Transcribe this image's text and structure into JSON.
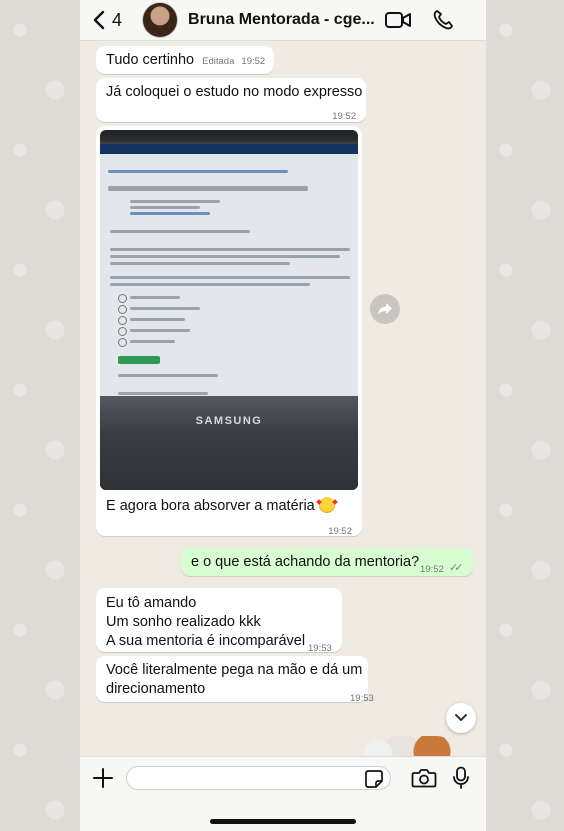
{
  "header": {
    "back_count": "4",
    "contact_name": "Bruna Mentorada - cge...",
    "icons": [
      "chevron-left-icon",
      "video-call-icon",
      "phone-call-icon"
    ]
  },
  "messages": [
    {
      "direction": "in",
      "text": "Tudo certinho",
      "edited_label": "Editada",
      "time": "19:52"
    },
    {
      "direction": "in",
      "text": "Já coloquei o estudo no modo expresso",
      "time": "19:52"
    },
    {
      "direction": "in",
      "type": "image",
      "image_text": "SAMSUNG",
      "caption": "E agora bora absorver a matéria",
      "caption_emoji": "smiling-face-with-hearts",
      "time": "19:52"
    },
    {
      "direction": "out",
      "text": "e o que está achando da mentoria?",
      "time": "19:52",
      "status": "read"
    },
    {
      "direction": "in",
      "lines": [
        "Eu tô amando",
        "Um sonho realizado kkk",
        "A sua mentoria é incomparável"
      ],
      "time": "19:53"
    },
    {
      "direction": "in",
      "lines": [
        "Você literalmente pega na mão e dá um",
        "direcionamento"
      ],
      "time": "19:53"
    }
  ],
  "composer": {
    "value": "",
    "icons": [
      "plus-icon",
      "sticker-icon",
      "camera-icon",
      "microphone-icon"
    ]
  },
  "colors": {
    "chat_background": "#efeae2",
    "incoming_bubble": "#ffffff",
    "outgoing_bubble": "#d9fdd3"
  }
}
